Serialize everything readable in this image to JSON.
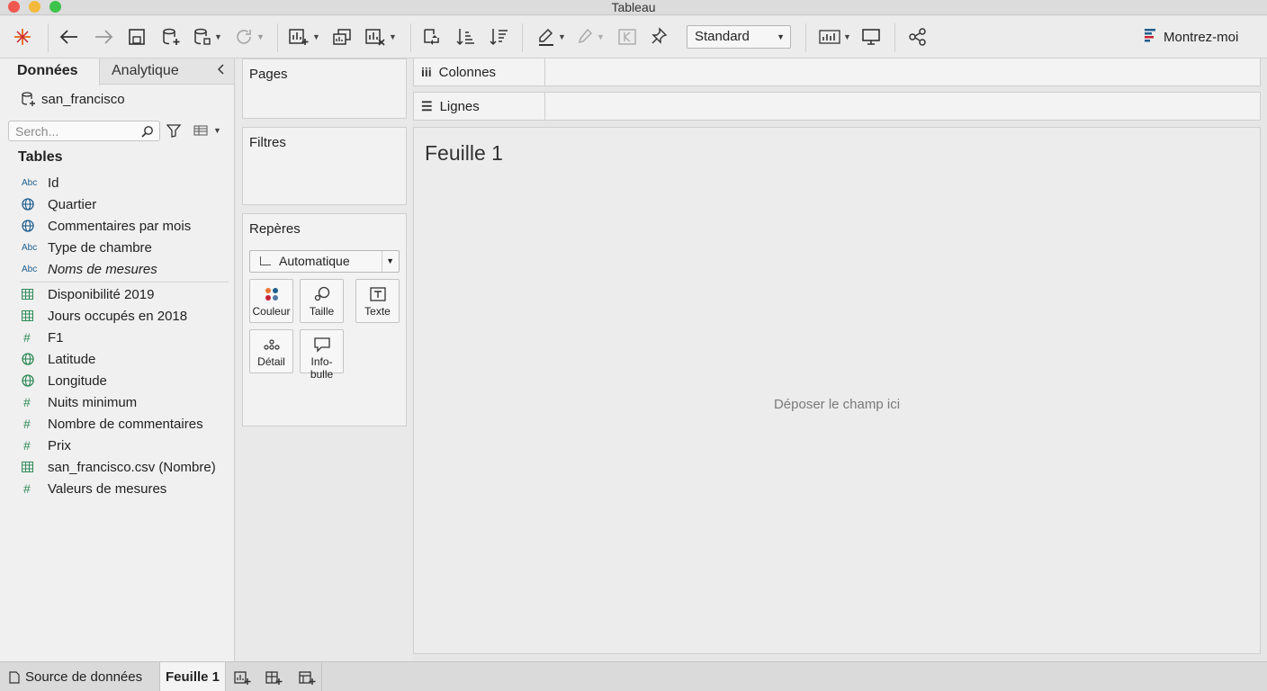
{
  "window": {
    "title": "Tableau"
  },
  "toolbar": {
    "fit_value": "Standard",
    "show_me_label": "Montrez-moi"
  },
  "data_pane": {
    "tabs": [
      {
        "label": "Données"
      },
      {
        "label": "Analytique"
      }
    ],
    "datasource": "san_francisco",
    "search_placeholder": "Serch...",
    "tables_heading": "Tables",
    "dimensions": [
      {
        "type": "Abc",
        "label": "Id"
      },
      {
        "type": "geo",
        "label": "Quartier"
      },
      {
        "type": "geo",
        "label": "Commentaires par mois"
      },
      {
        "type": "Abc",
        "label": "Type de chambre"
      },
      {
        "type": "Abc",
        "label": "Noms de mesures"
      }
    ],
    "measures": [
      {
        "type": "table",
        "label": "Disponibilité 2019"
      },
      {
        "type": "table",
        "label": "Jours occupés en 2018"
      },
      {
        "type": "#",
        "label": "F1"
      },
      {
        "type": "geo",
        "label": "Latitude"
      },
      {
        "type": "geo",
        "label": "Longitude"
      },
      {
        "type": "#",
        "label": "Nuits minimum"
      },
      {
        "type": "#",
        "label": "Nombre de commentaires"
      },
      {
        "type": "#",
        "label": "Prix"
      },
      {
        "type": "table",
        "label": "san_francisco.csv (Nombre)"
      },
      {
        "type": "#",
        "label": "Valeurs de mesures"
      }
    ]
  },
  "cards": {
    "pages": "Pages",
    "filters": "Filtres",
    "marks": {
      "title": "Repères",
      "mark_type": "Automatique",
      "buttons": [
        "Couleur",
        "Taille",
        "Texte",
        "Détail",
        "Info-bulle"
      ]
    }
  },
  "shelves": {
    "columns": "Colonnes",
    "rows": "Lignes"
  },
  "view": {
    "sheet_title": "Feuille 1",
    "drop_hint": "Déposer le champ ici"
  },
  "bottom_tabs": {
    "data_source": "Source de données",
    "sheet": "Feuille 1"
  },
  "colors": {
    "accent": "#1f5e8f",
    "measure": "#2e8b57",
    "tableau_logo": "#e8762c"
  }
}
